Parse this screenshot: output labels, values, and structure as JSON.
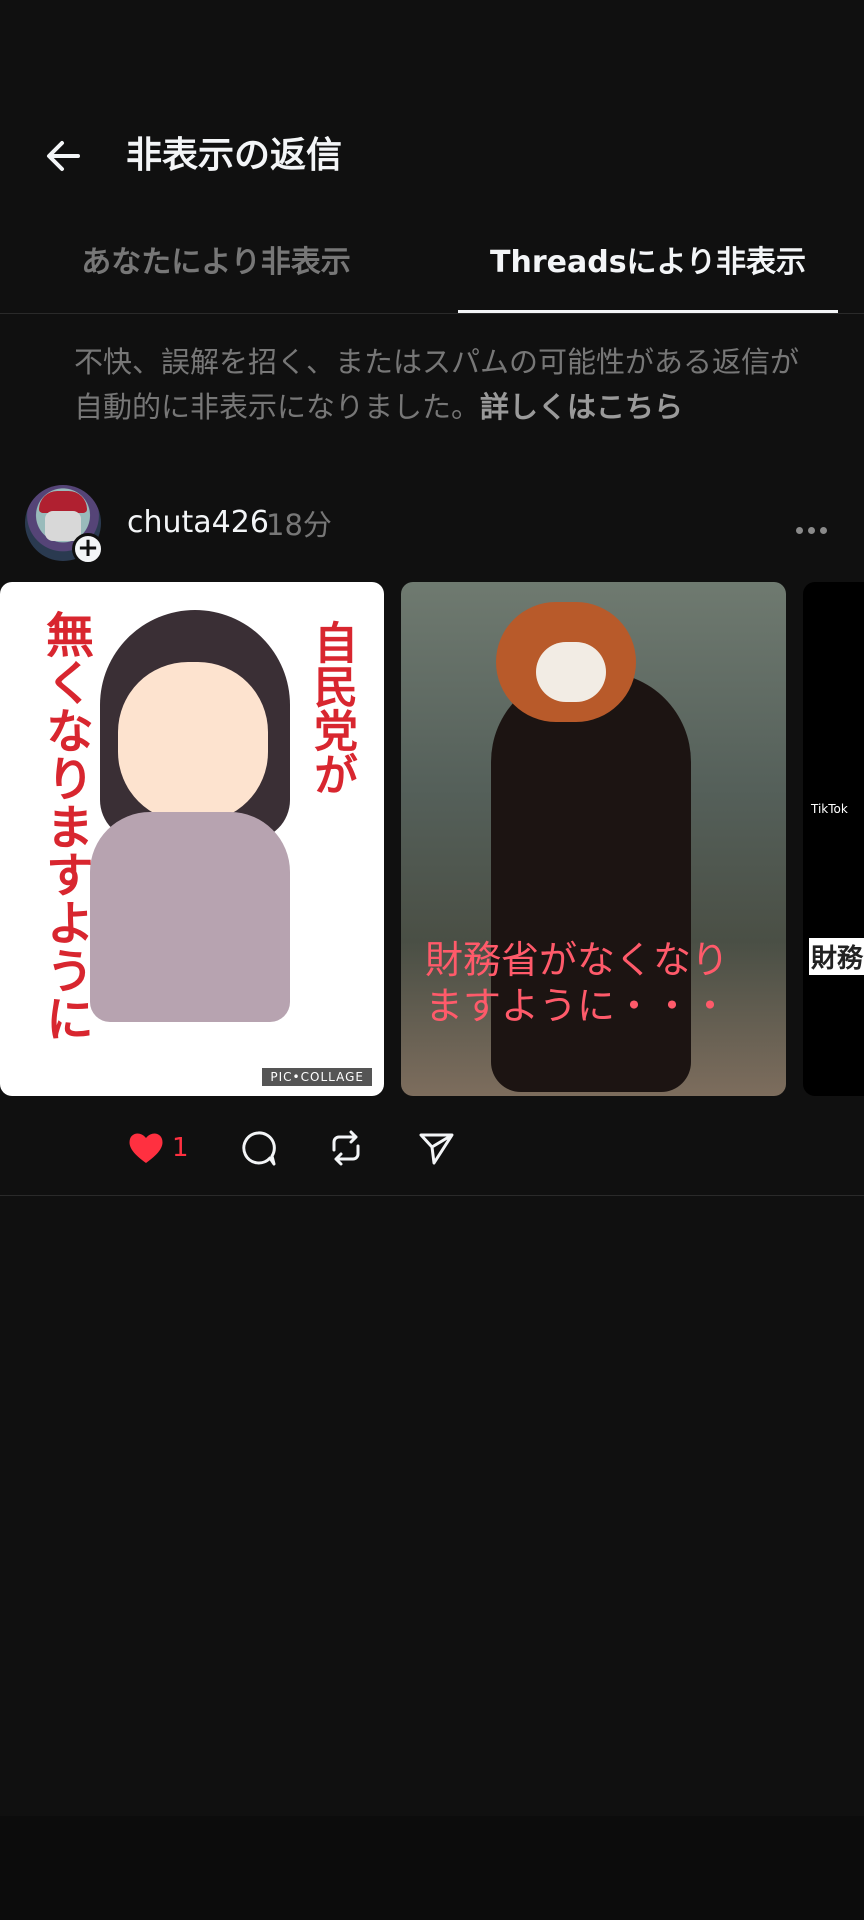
{
  "header": {
    "title": "非表示の返信"
  },
  "tabs": [
    {
      "label": "あなたにより非表示",
      "active": false
    },
    {
      "label": "Threadsにより非表示",
      "active": true
    }
  ],
  "notice": {
    "text": "不快、誤解を招く、またはスパムの可能性がある返信が自動的に非表示になりました。",
    "link": "詳しくはこちら"
  },
  "post": {
    "username": "chuta426",
    "time": "18分",
    "images": [
      {
        "text_right": "自民党が",
        "text_left": "無くなりますように",
        "watermark": "PIC•COLLAGE"
      },
      {
        "caption": "財務省がなくなりますように・・・"
      },
      {
        "badge": "TikTok",
        "caption": "財務"
      }
    ],
    "likes": "1"
  },
  "colors": {
    "accent_like": "#ff3040",
    "background": "#101010",
    "text_primary": "#f3f5f7",
    "text_secondary": "#777777"
  },
  "icons": [
    "back-arrow-icon",
    "plus-icon",
    "more-icon",
    "heart-icon",
    "comment-icon",
    "repost-icon",
    "share-icon"
  ]
}
